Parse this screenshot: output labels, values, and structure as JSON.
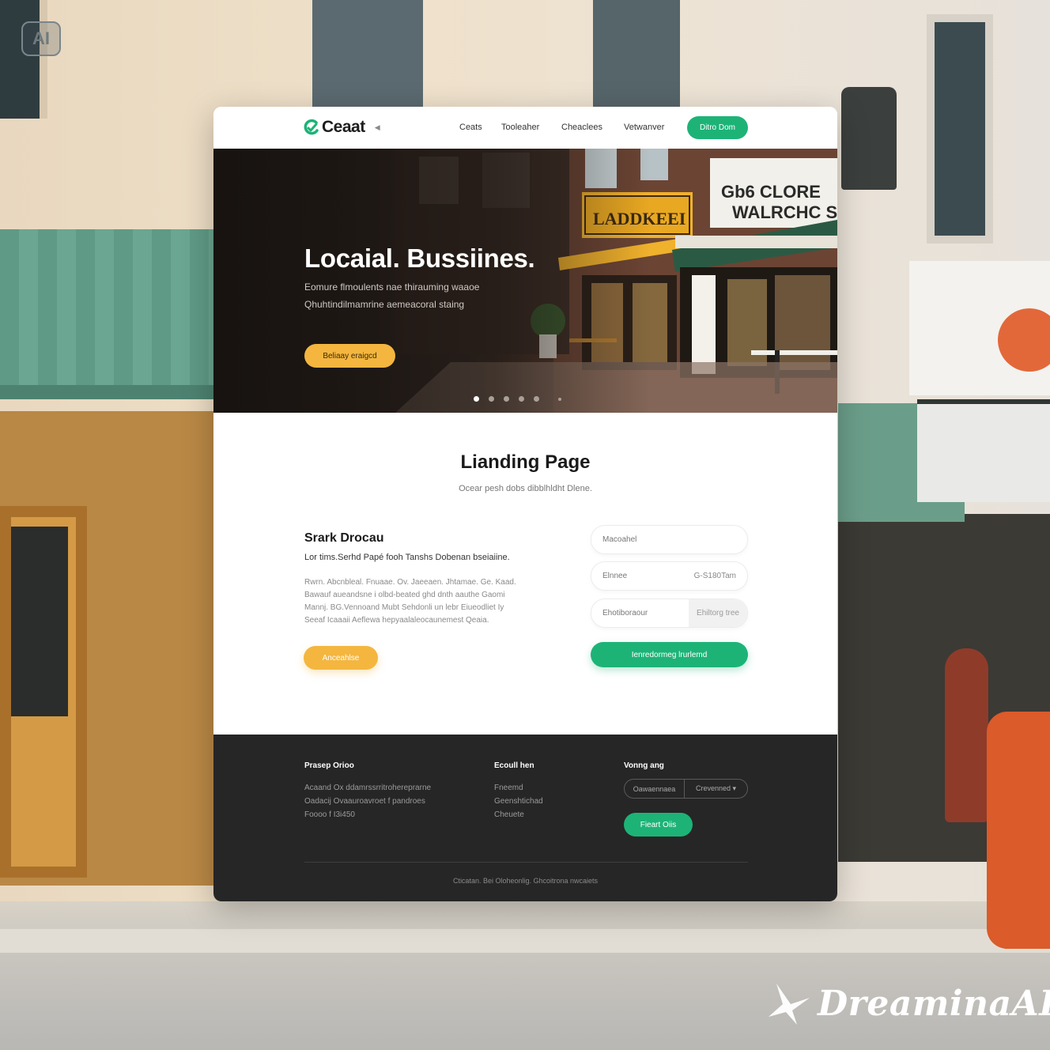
{
  "badge": {
    "label": "AI"
  },
  "nav": {
    "brand": "Ceaat",
    "links": [
      "Ceats",
      "Tooleaher",
      "Cheaclees",
      "Vetwanver"
    ],
    "cta": "Ditro Dom"
  },
  "hero": {
    "title": "Locaial. Bussiines.",
    "subtitle_lines": [
      "Eomure flmoulents nae thirauming waaoe",
      "Qhuhtindilmamrine aemeacoral staing"
    ],
    "cta": "Beliaay eraigcd",
    "slides_total": 6,
    "active_slide": 1
  },
  "section": {
    "title": "Lianding Page",
    "subtitle": "Ocear pesh dobs dibblhldht Dlene."
  },
  "about": {
    "title": "Srark Drocau",
    "lead": "Lor tims.Serhd Papé fooh Tanshs Dobenan bseiaiine.",
    "body_lines": [
      "Rwrn. Abcnbleal. Fnuaae. Ov. Jaeeaen. Jhtamae. Ge. Kaad.",
      "Bawauf aueandsne i olbd-beated ghd dnth aauthe Gaomi",
      "Mannj. BG.Vennoand Mubt Sehdonli un lebr Eiueodliet Iy",
      "Seeaf Icaaaii Aeflewa hepyaalaleocaunemest Qeaia."
    ],
    "cta": "Anceahlse"
  },
  "form": {
    "field1_placeholder": "Macoahel",
    "field2_label": "Elnnee",
    "field2_value": "G-S180Tam",
    "field3_label": "Ehotiboraour",
    "field3_select": "Ehiltorg tree",
    "submit": "Ienredormeg lrurlemd"
  },
  "footer": {
    "col1": {
      "heading": "Prasep Orioo",
      "lines": [
        "Acaand Ox ddamrssrritrohereprarne",
        "Oadacij Ovaauroavroet f pandroes",
        "Foooo f I3i450"
      ]
    },
    "col2": {
      "heading": "Ecoull hen",
      "lines": [
        "Fneemd",
        "Geenshtichad",
        "Cheuete"
      ]
    },
    "col3": {
      "heading": "Vonng ang",
      "input": "Oawaennaea",
      "select": "Crevenned",
      "cta": "Fieart Oiis"
    },
    "copyright": "Cticatan. Bei Oloheonlig. Ghcoitrona nwcaiets"
  },
  "watermark": {
    "label": "DreaminaAI"
  },
  "colors": {
    "brand_green": "#1db377",
    "accent_yellow": "#f4b63f",
    "footer_bg": "#262626",
    "text_dark": "#1a1a1a"
  }
}
